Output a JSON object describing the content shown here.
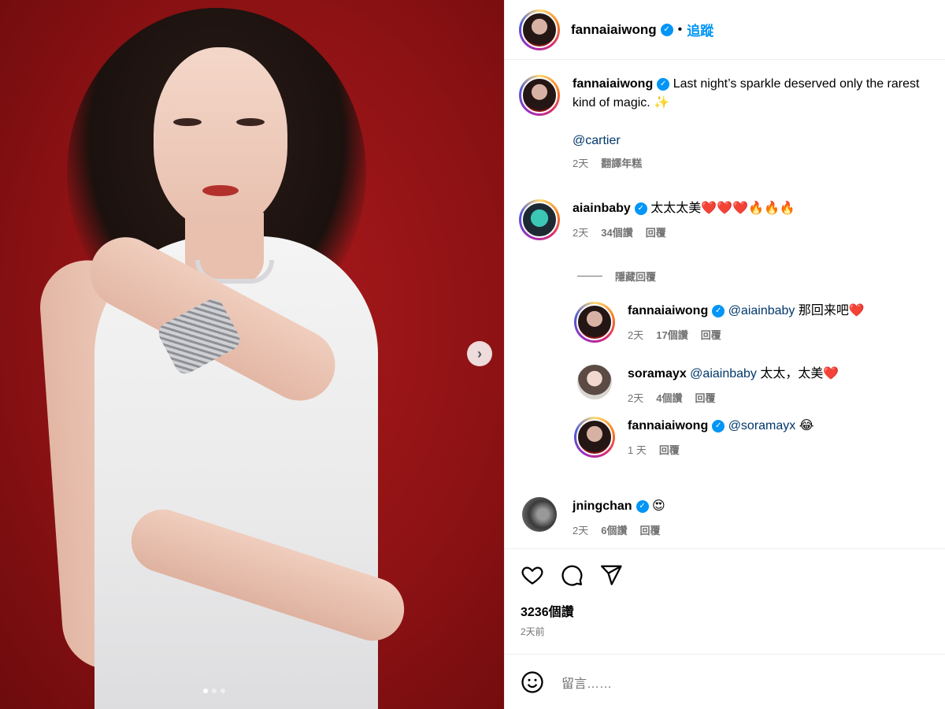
{
  "post": {
    "author": "fannaiaiwong",
    "follow_label": "追蹤",
    "separator": "•"
  },
  "caption": {
    "author": "fannaiaiwong",
    "line1": "Last night’s sparkle deserved only the rarest",
    "line2": "kind of magic. ✨",
    "mention": "@cartier",
    "time": "2天",
    "translate": "翻譯年糕"
  },
  "comments": [
    {
      "user": "aiainbaby",
      "text": "太太太美❤️❤️❤️🔥🔥🔥",
      "time": "2天",
      "likes": "34個讚",
      "reply": "回覆"
    },
    {
      "user": "fannaiaiwong",
      "mention": "@aiainbaby",
      "text": "那回来吧❤️",
      "time": "2天",
      "likes": "17個讚",
      "reply": "回覆"
    },
    {
      "user": "soramayx",
      "mention": "@aiainbaby",
      "text": "太太，太美❤️",
      "time": "2天",
      "likes": "4個讚",
      "reply": "回覆"
    },
    {
      "user": "fannaiaiwong",
      "mention": "@soramayx",
      "text": "😂",
      "time": "1 天",
      "reply": "回覆"
    },
    {
      "user": "jningchan",
      "text": "😍",
      "time": "2天",
      "likes": "6個讚",
      "reply": "回覆"
    }
  ],
  "hide_replies": "隱藏回覆",
  "likes_total": "3236個讚",
  "posted_ago": "2天前",
  "compose": {
    "placeholder": "留言……"
  },
  "carousel": {
    "slides": 3,
    "active": 1
  },
  "icons": [
    "heart-icon",
    "comment-icon",
    "share-icon",
    "emoji-icon",
    "chevron-right-icon",
    "verified-icon"
  ],
  "colors": {
    "accent": "#0095f6",
    "muted": "#737373",
    "mention": "#00376b"
  }
}
